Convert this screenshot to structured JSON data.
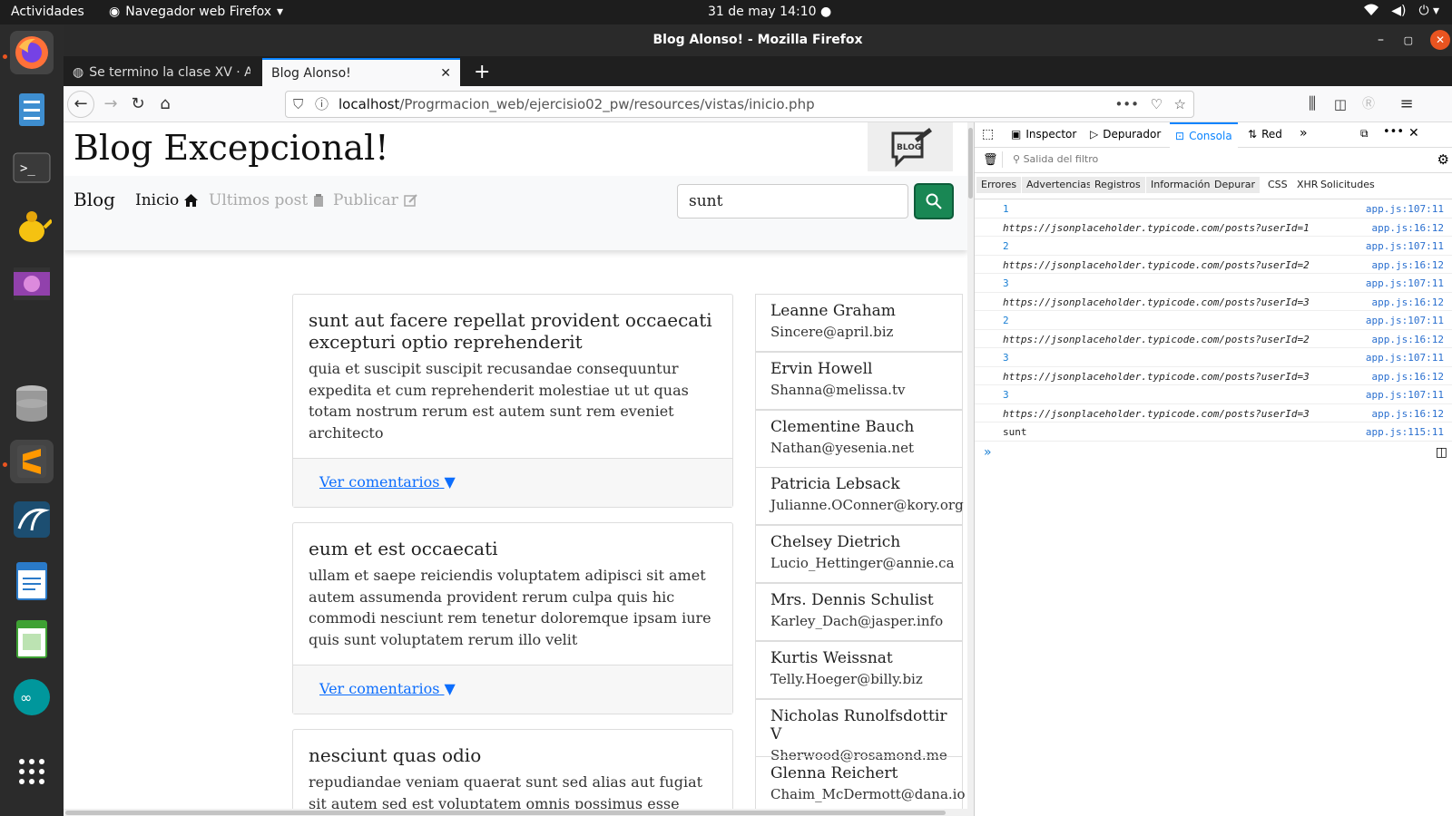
{
  "os": {
    "activities": "Actividades",
    "app_menu": "Navegador web Firefox",
    "clock": "31 de may  14:10"
  },
  "window": {
    "title": "Blog Alonso! - Mozilla Firefox",
    "tabs": [
      {
        "label": "Se termino la clase XV · A"
      },
      {
        "label": "Blog Alonso!"
      }
    ],
    "url_host": "localhost",
    "url_path": "/Progrmacion_web/ejercisio02_pw/resources/vistas/inicio.php"
  },
  "page": {
    "title": "Blog Excepcional!",
    "logo_text": "BLOG",
    "brand": "Blog",
    "nav": [
      {
        "label": "Inicio"
      },
      {
        "label": "Ultimos post"
      },
      {
        "label": "Publicar"
      }
    ],
    "search_value": "sunt",
    "posts": [
      {
        "title": "sunt aut facere repellat provident occaecati excepturi optio reprehenderit",
        "body": "quia et suscipit suscipit recusandae consequuntur expedita et cum reprehenderit molestiae ut ut quas totam nostrum rerum est autem sunt rem eveniet architecto",
        "link": "Ver comentarios"
      },
      {
        "title": "eum et est occaecati",
        "body": "ullam et saepe reiciendis voluptatem adipisci sit amet autem assumenda provident rerum culpa quis hic commodi nesciunt rem tenetur doloremque ipsam iure quis sunt voluptatem rerum illo velit",
        "link": "Ver comentarios"
      },
      {
        "title": "nesciunt quas odio",
        "body": "repudiandae veniam quaerat sunt sed alias aut fugiat sit autem sed est voluptatem omnis possimus esse"
      }
    ],
    "users": [
      {
        "name": "Leanne Graham",
        "email": "Sincere@april.biz"
      },
      {
        "name": "Ervin Howell",
        "email": "Shanna@melissa.tv"
      },
      {
        "name": "Clementine Bauch",
        "email": "Nathan@yesenia.net"
      },
      {
        "name": "Patricia Lebsack",
        "email": "Julianne.OConner@kory.org"
      },
      {
        "name": "Chelsey Dietrich",
        "email": "Lucio_Hettinger@annie.ca"
      },
      {
        "name": "Mrs. Dennis Schulist",
        "email": "Karley_Dach@jasper.info"
      },
      {
        "name": "Kurtis Weissnat",
        "email": "Telly.Hoeger@billy.biz"
      },
      {
        "name": "Nicholas Runolfsdottir V",
        "email": "Sherwood@rosamond.me"
      },
      {
        "name": "Glenna Reichert",
        "email": "Chaim_McDermott@dana.io"
      }
    ]
  },
  "devtools": {
    "tabs": [
      "Inspector",
      "Depurador",
      "Consola",
      "Red"
    ],
    "filter_placeholder": "Salida del filtro",
    "filters": [
      "Errores",
      "Advertencias",
      "Registros",
      "Información",
      "Depurar",
      "CSS",
      "XHR",
      "Solicitudes"
    ],
    "logs": [
      {
        "msg": "1",
        "src": "app.js:107:11",
        "num": true
      },
      {
        "msg": "https://jsonplaceholder.typicode.com/posts?userId=1",
        "src": "app.js:16:12"
      },
      {
        "msg": "2",
        "src": "app.js:107:11",
        "num": true
      },
      {
        "msg": "https://jsonplaceholder.typicode.com/posts?userId=2",
        "src": "app.js:16:12"
      },
      {
        "msg": "3",
        "src": "app.js:107:11",
        "num": true
      },
      {
        "msg": "https://jsonplaceholder.typicode.com/posts?userId=3",
        "src": "app.js:16:12"
      },
      {
        "msg": "2",
        "src": "app.js:107:11",
        "num": true
      },
      {
        "msg": "https://jsonplaceholder.typicode.com/posts?userId=2",
        "src": "app.js:16:12"
      },
      {
        "msg": "3",
        "src": "app.js:107:11",
        "num": true
      },
      {
        "msg": "https://jsonplaceholder.typicode.com/posts?userId=3",
        "src": "app.js:16:12"
      },
      {
        "msg": "3",
        "src": "app.js:107:11",
        "num": true
      },
      {
        "msg": "https://jsonplaceholder.typicode.com/posts?userId=3",
        "src": "app.js:16:12"
      },
      {
        "msg": "sunt",
        "src": "app.js:115:11"
      }
    ]
  }
}
